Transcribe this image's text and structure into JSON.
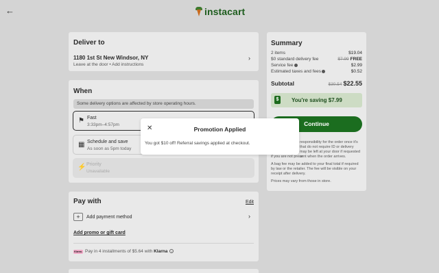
{
  "header": {
    "back_icon": "arrow-left-icon",
    "logo_text": "instacart",
    "logo_colors": {
      "leaf": "#3d7a2e",
      "carrot": "#c96a1c",
      "word": "#1d5c1d"
    }
  },
  "deliver": {
    "title": "Deliver to",
    "address": "1180 1st St New Windsor, NY",
    "instructions": "Leave at the door • Add instructions"
  },
  "when": {
    "title": "When",
    "notice": "Some delivery options are affected by store operating hours.",
    "options": [
      {
        "icon": "fast-delivery-icon",
        "title": "Fast",
        "subtitle": "3:33pm–4:57pm",
        "selected": true
      },
      {
        "icon": "calendar-icon",
        "title": "Schedule and save",
        "subtitle": "As soon as 5pm today",
        "selected": false
      },
      {
        "icon": "lightning-icon",
        "title": "Priority",
        "subtitle": "Unavailable",
        "selected": false
      }
    ]
  },
  "pay": {
    "title": "Pay with",
    "edit_label": "Edit",
    "add_payment": "Add payment method",
    "promo_link": "Add promo or gift card",
    "klarna_badge": "Klarna.",
    "klarna_prefix": "Pay in 4 installments of $5.64 with",
    "klarna_brand": "Klarna"
  },
  "summary": {
    "title": "Summary",
    "rows": [
      {
        "label": "2 items",
        "old": "",
        "value": "$19.04"
      },
      {
        "label": "$0 standard delivery fee",
        "old": "$7.99",
        "value": "FREE"
      },
      {
        "label": "Service fee",
        "old": "",
        "value": "$2.99"
      },
      {
        "label": "Estimated taxes and fees",
        "old": "",
        "value": "$0.52"
      }
    ],
    "subtotal_label": "Subtotal",
    "subtotal_old": "$30.54",
    "subtotal_value": "$22.55",
    "saving_text": "You're saving $7.99",
    "continue_label": "Continue",
    "fine_1_a": "responsibility for the order once it's",
    "fine_1_b": "that do not require ID or delivery",
    "fine_1_c": "may be left at your door if requested or",
    "fine_1_d": "if you are not present when the order arrives.",
    "fine_2": "A bag fee may be added to your final total if required by law or the retailer. The fee will be visible on your receipt after delivery.",
    "fine_3": "Prices may vary from those in store."
  },
  "modal": {
    "title": "Promotion Applied",
    "body": "You got $10 off! Referral savings applied at checkout."
  }
}
